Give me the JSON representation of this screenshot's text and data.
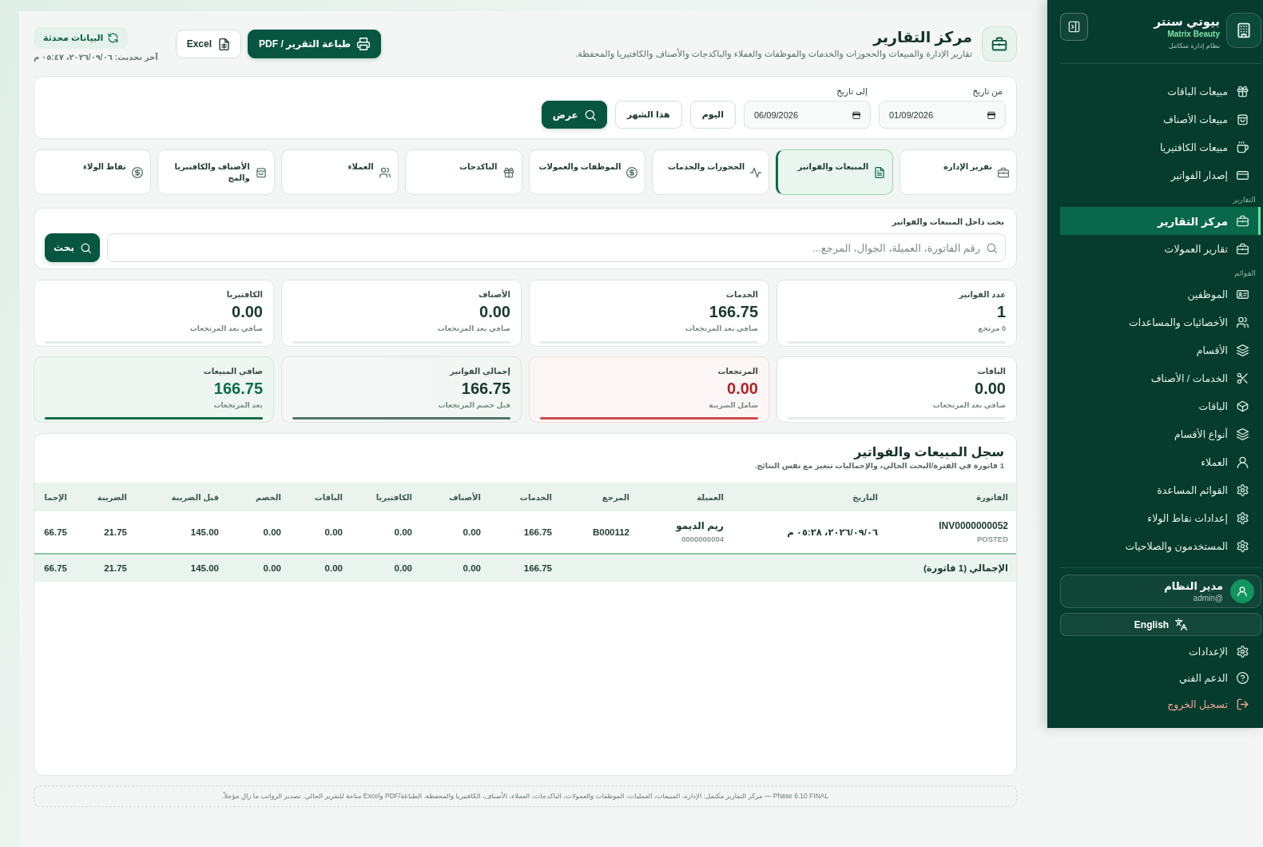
{
  "sidebar": {
    "brand": {
      "name": "بيوتي سنتر",
      "product": "Matrix Beauty",
      "tagline": "نظام إدارة متكامل"
    },
    "groups": [
      {
        "items": [
          {
            "label": "مبيعات الباقات",
            "selected": false
          },
          {
            "label": "مبيعات الأصناف",
            "selected": false
          },
          {
            "label": "مبيعات الكافتيريا",
            "selected": false
          },
          {
            "label": "إصدار الفواتير",
            "selected": false
          }
        ]
      },
      {
        "title": "التقارير",
        "items": [
          {
            "label": "مركز التقارير",
            "selected": true
          },
          {
            "label": "تقارير العمولات",
            "selected": false
          }
        ]
      },
      {
        "title": "القوائم",
        "items": [
          {
            "label": "الموظفين",
            "selected": false
          },
          {
            "label": "الأخصائيات والمساعدات",
            "selected": false
          },
          {
            "label": "الأقسام",
            "selected": false
          },
          {
            "label": "الخدمات / الأصناف",
            "selected": false
          },
          {
            "label": "الباقات",
            "selected": false
          },
          {
            "label": "أنواع الأقسام",
            "selected": false
          },
          {
            "label": "العملاء",
            "selected": false
          },
          {
            "label": "القوائم المساعدة",
            "selected": false
          },
          {
            "label": "إعدادات نقاط الولاء",
            "selected": false
          },
          {
            "label": "المستخدمون والصلاحيات",
            "selected": false
          }
        ]
      }
    ],
    "user": {
      "name": "مدير النظام",
      "handle": "@admin"
    },
    "language_button": "English",
    "footer_items": [
      {
        "label": "الإعدادات",
        "kind": "link"
      },
      {
        "label": "الدعم الفني",
        "kind": "link"
      },
      {
        "label": "تسجيل الخروج",
        "kind": "logout"
      }
    ]
  },
  "header": {
    "title": "مركز التقارير",
    "subtitle": "تقارير الإدارة والمبيعات والحجوزات والخدمات والموظفات والعملاء والباكدجات والأصناف والكافتيريا والمحفظة.",
    "print_button": "طباعة التقرير / PDF",
    "excel_button": "Excel",
    "status": "البيانات محدثة",
    "last_updated": "آخر تحديث: ٠٦‏/٠٩‏/٢٠٢٦، ٠٥:٤٧ م"
  },
  "filters": {
    "from": {
      "label": "من تاريخ",
      "value": "01/09/2026"
    },
    "to": {
      "label": "إلى تاريخ",
      "value": "06/09/2026"
    },
    "quick_buttons": [
      "اليوم",
      "هذا الشهر"
    ],
    "apply_button": "عرض"
  },
  "report_tabs": [
    {
      "label": "تقرير الإدارة",
      "selected": false
    },
    {
      "label": "المبيعات والفواتير",
      "selected": true
    },
    {
      "label": "الحجوزات والخدمات",
      "selected": false
    },
    {
      "label": "الموظفات والعمولات",
      "selected": false
    },
    {
      "label": "الباكدجات",
      "selected": false
    },
    {
      "label": "العملاء",
      "selected": false
    },
    {
      "label": "الأصناف والكافتيريا والمح",
      "selected": false
    },
    {
      "label": "نقاط الولاء",
      "selected": false
    }
  ],
  "search": {
    "label": "بحث داخل المبيعات والفواتير",
    "placeholder": "رقم الفاتورة، العميلة، الجوال، المرجع...",
    "button": "بحث"
  },
  "stats": [
    {
      "label": "عدد الفواتير",
      "value": "1",
      "note": "0 مرتجع",
      "kind": "plain"
    },
    {
      "label": "الخدمات",
      "value": "166.75",
      "note": "صافي بعد المرتجعات",
      "kind": "plain"
    },
    {
      "label": "الأصناف",
      "value": "0.00",
      "note": "صافي بعد المرتجعات",
      "kind": "plain"
    },
    {
      "label": "الكافتيريا",
      "value": "0.00",
      "note": "صافي بعد المرتجعات",
      "kind": "plain"
    },
    {
      "label": "الباقات",
      "value": "0.00",
      "note": "صافي بعد المرتجعات",
      "kind": "plain"
    },
    {
      "label": "المرتجعات",
      "value": "0.00",
      "note": "شامل الضريبة",
      "kind": "danger"
    },
    {
      "label": "إجمالي الفواتير",
      "value": "166.75",
      "note": "قبل خصم المرتجعات",
      "kind": "total"
    },
    {
      "label": "صافي المبيعات",
      "value": "166.75",
      "note": "بعد المرتجعات",
      "kind": "net"
    }
  ],
  "sales_log": {
    "title": "سجل المبيعات والفواتير",
    "subtitle": "1 فاتورة في الفترة/البحث الحالي، والإجماليات تتغير مع نفس النتائج.",
    "columns": [
      "الفاتورة",
      "التاريخ",
      "العميلة",
      "المرجع",
      "الخدمات",
      "الأصناف",
      "الكافتيريا",
      "الباقات",
      "الخصم",
      "قبل الضريبة",
      "الضريبة",
      "الإجما"
    ],
    "rows": [
      {
        "invoice": "INV0000000052",
        "status": "POSTED",
        "date": "٠٦‏/٠٩‏/٢٠٢٦، ٠٥:٢٨ م",
        "customer": "ريم الديمو",
        "customer_code": "0000000004",
        "reference": "B000112",
        "amounts": [
          "166.75",
          "0.00",
          "0.00",
          "0.00",
          "0.00",
          "145.00",
          "21.75",
          "66.75"
        ]
      }
    ],
    "totals": {
      "label": "الإجمالي (1 فاتورة)",
      "amounts": [
        "166.75",
        "0.00",
        "0.00",
        "0.00",
        "0.00",
        "145.00",
        "21.75",
        "66.75"
      ]
    }
  },
  "footer_note": "Phase 6.10 FINAL — مركز التقارير مكتمل: الإدارة، المبيعات، العمليات، الموظفات والعمولات، الباكدجات، العملاء، الأصناف، الكافتيريا والمحفظة. الطباعة/PDF وExcel متاحة للتقرير الحالي. تصدير الرواتب ما زال مؤجلاً."
}
